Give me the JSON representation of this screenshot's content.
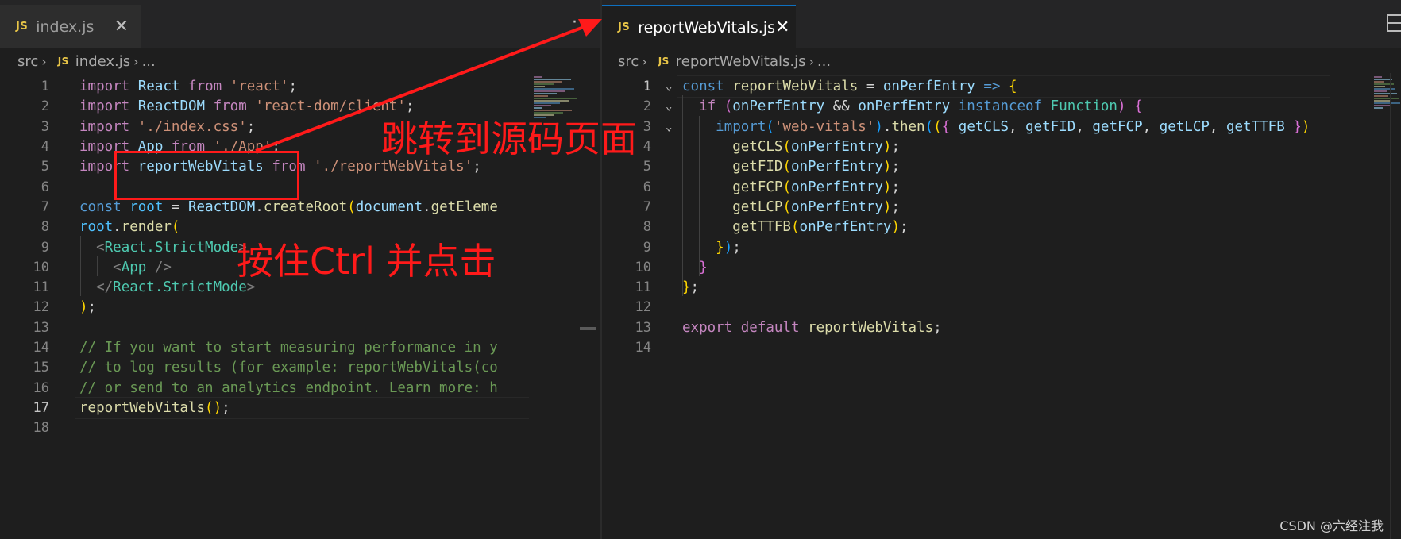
{
  "left_editor": {
    "tab": {
      "badge": "JS",
      "label": "index.js",
      "close_glyph": "✕"
    },
    "more_glyph": "···",
    "breadcrumb": {
      "folder": "src",
      "badge": "JS",
      "file": "index.js",
      "tail": "..."
    },
    "lines": [
      {
        "n": "1",
        "tokens": [
          [
            "imp",
            "import"
          ],
          [
            "pun",
            " "
          ],
          [
            "id",
            "React"
          ],
          [
            "pun",
            " "
          ],
          [
            "imp",
            "from"
          ],
          [
            "pun",
            " "
          ],
          [
            "str",
            "'react'"
          ],
          [
            "pun",
            ";"
          ]
        ]
      },
      {
        "n": "2",
        "tokens": [
          [
            "imp",
            "import"
          ],
          [
            "pun",
            " "
          ],
          [
            "id",
            "ReactDOM"
          ],
          [
            "pun",
            " "
          ],
          [
            "imp",
            "from"
          ],
          [
            "pun",
            " "
          ],
          [
            "str",
            "'react-dom/client'"
          ],
          [
            "pun",
            ";"
          ]
        ]
      },
      {
        "n": "3",
        "tokens": [
          [
            "imp",
            "import"
          ],
          [
            "pun",
            " "
          ],
          [
            "str",
            "'./index.css'"
          ],
          [
            "pun",
            ";"
          ]
        ]
      },
      {
        "n": "4",
        "tokens": [
          [
            "imp",
            "import"
          ],
          [
            "pun",
            " "
          ],
          [
            "id",
            "App"
          ],
          [
            "pun",
            " "
          ],
          [
            "imp",
            "from"
          ],
          [
            "pun",
            " "
          ],
          [
            "str",
            "'./App'"
          ],
          [
            "pun",
            ";"
          ]
        ]
      },
      {
        "n": "5",
        "tokens": [
          [
            "imp",
            "import"
          ],
          [
            "pun",
            " "
          ],
          [
            "id",
            "reportWebVitals"
          ],
          [
            "pun",
            " "
          ],
          [
            "imp",
            "from"
          ],
          [
            "pun",
            " "
          ],
          [
            "str",
            "'./reportWebVitals'"
          ],
          [
            "pun",
            ";"
          ]
        ]
      },
      {
        "n": "6",
        "tokens": []
      },
      {
        "n": "7",
        "tokens": [
          [
            "kw",
            "const"
          ],
          [
            "pun",
            " "
          ],
          [
            "cst",
            "root"
          ],
          [
            "pun",
            " = "
          ],
          [
            "id",
            "ReactDOM"
          ],
          [
            "pun",
            "."
          ],
          [
            "fn",
            "createRoot"
          ],
          [
            "b1",
            "("
          ],
          [
            "id",
            "document"
          ],
          [
            "pun",
            "."
          ],
          [
            "fn",
            "getEleme"
          ]
        ]
      },
      {
        "n": "8",
        "tokens": [
          [
            "cst",
            "root"
          ],
          [
            "pun",
            "."
          ],
          [
            "fn",
            "render"
          ],
          [
            "b1",
            "("
          ]
        ]
      },
      {
        "n": "9",
        "tokens": [
          [
            "pun",
            "  "
          ],
          [
            "tag",
            "<"
          ],
          [
            "cls",
            "React.StrictMode"
          ],
          [
            "tag",
            ">"
          ]
        ]
      },
      {
        "n": "10",
        "tokens": [
          [
            "pun",
            "    "
          ],
          [
            "tag",
            "<"
          ],
          [
            "cls",
            "App"
          ],
          [
            "pun",
            " "
          ],
          [
            "tag",
            "/>"
          ]
        ]
      },
      {
        "n": "11",
        "tokens": [
          [
            "pun",
            "  "
          ],
          [
            "tag",
            "</"
          ],
          [
            "cls",
            "React.StrictMode"
          ],
          [
            "tag",
            ">"
          ]
        ]
      },
      {
        "n": "12",
        "tokens": [
          [
            "b1",
            ")"
          ],
          [
            "pun",
            ";"
          ]
        ]
      },
      {
        "n": "13",
        "tokens": []
      },
      {
        "n": "14",
        "tokens": [
          [
            "cmt",
            "// If you want to start measuring performance in y"
          ]
        ]
      },
      {
        "n": "15",
        "tokens": [
          [
            "cmt",
            "// to log results (for example: reportWebVitals(co"
          ]
        ]
      },
      {
        "n": "16",
        "tokens": [
          [
            "cmt",
            "// or send to an analytics endpoint. Learn more: h"
          ]
        ]
      },
      {
        "n": "17",
        "tokens": [
          [
            "fn",
            "reportWebVitals"
          ],
          [
            "b1",
            "()"
          ],
          [
            "pun",
            ";"
          ]
        ],
        "active": true
      },
      {
        "n": "18",
        "tokens": []
      }
    ]
  },
  "right_editor": {
    "tab": {
      "badge": "JS",
      "label": "reportWebVitals.js",
      "close_glyph": "✕"
    },
    "breadcrumb": {
      "folder": "src",
      "badge": "JS",
      "file": "reportWebVitals.js",
      "tail": "..."
    },
    "lines": [
      {
        "n": "1",
        "fold": true,
        "active": true,
        "tokens": [
          [
            "kw",
            "const"
          ],
          [
            "pun",
            " "
          ],
          [
            "fn",
            "reportWebVitals"
          ],
          [
            "pun",
            " = "
          ],
          [
            "id",
            "onPerfEntry"
          ],
          [
            "pun",
            " "
          ],
          [
            "kw",
            "=>"
          ],
          [
            "pun",
            " "
          ],
          [
            "b1",
            "{"
          ]
        ]
      },
      {
        "n": "2",
        "fold": true,
        "tokens": [
          [
            "pun",
            "  "
          ],
          [
            "imp",
            "if"
          ],
          [
            "pun",
            " "
          ],
          [
            "b2",
            "("
          ],
          [
            "id",
            "onPerfEntry"
          ],
          [
            "pun",
            " && "
          ],
          [
            "id",
            "onPerfEntry"
          ],
          [
            "pun",
            " "
          ],
          [
            "kw",
            "instanceof"
          ],
          [
            "pun",
            " "
          ],
          [
            "cls",
            "Function"
          ],
          [
            "b2",
            ")"
          ],
          [
            "pun",
            " "
          ],
          [
            "b2",
            "{"
          ]
        ]
      },
      {
        "n": "3",
        "fold": true,
        "tokens": [
          [
            "pun",
            "    "
          ],
          [
            "kw",
            "import"
          ],
          [
            "b3",
            "("
          ],
          [
            "str",
            "'web-vitals'"
          ],
          [
            "b3",
            ")"
          ],
          [
            "pun",
            "."
          ],
          [
            "fn",
            "then"
          ],
          [
            "b3",
            "("
          ],
          [
            "b1",
            "("
          ],
          [
            "b2",
            "{"
          ],
          [
            "pun",
            " "
          ],
          [
            "id",
            "getCLS"
          ],
          [
            "pun",
            ", "
          ],
          [
            "id",
            "getFID"
          ],
          [
            "pun",
            ", "
          ],
          [
            "id",
            "getFCP"
          ],
          [
            "pun",
            ", "
          ],
          [
            "id",
            "getLCP"
          ],
          [
            "pun",
            ", "
          ],
          [
            "id",
            "getTTFB"
          ],
          [
            "pun",
            " "
          ],
          [
            "b2",
            "}"
          ],
          [
            "b1",
            ")"
          ]
        ]
      },
      {
        "n": "4",
        "tokens": [
          [
            "pun",
            "      "
          ],
          [
            "fn",
            "getCLS"
          ],
          [
            "b1",
            "("
          ],
          [
            "id",
            "onPerfEntry"
          ],
          [
            "b1",
            ")"
          ],
          [
            "pun",
            ";"
          ]
        ]
      },
      {
        "n": "5",
        "tokens": [
          [
            "pun",
            "      "
          ],
          [
            "fn",
            "getFID"
          ],
          [
            "b1",
            "("
          ],
          [
            "id",
            "onPerfEntry"
          ],
          [
            "b1",
            ")"
          ],
          [
            "pun",
            ";"
          ]
        ]
      },
      {
        "n": "6",
        "tokens": [
          [
            "pun",
            "      "
          ],
          [
            "fn",
            "getFCP"
          ],
          [
            "b1",
            "("
          ],
          [
            "id",
            "onPerfEntry"
          ],
          [
            "b1",
            ")"
          ],
          [
            "pun",
            ";"
          ]
        ]
      },
      {
        "n": "7",
        "tokens": [
          [
            "pun",
            "      "
          ],
          [
            "fn",
            "getLCP"
          ],
          [
            "b1",
            "("
          ],
          [
            "id",
            "onPerfEntry"
          ],
          [
            "b1",
            ")"
          ],
          [
            "pun",
            ";"
          ]
        ]
      },
      {
        "n": "8",
        "tokens": [
          [
            "pun",
            "      "
          ],
          [
            "fn",
            "getTTFB"
          ],
          [
            "b1",
            "("
          ],
          [
            "id",
            "onPerfEntry"
          ],
          [
            "b1",
            ")"
          ],
          [
            "pun",
            ";"
          ]
        ]
      },
      {
        "n": "9",
        "tokens": [
          [
            "pun",
            "    "
          ],
          [
            "b1",
            "}"
          ],
          [
            "b3",
            ")"
          ],
          [
            "pun",
            ";"
          ]
        ]
      },
      {
        "n": "10",
        "tokens": [
          [
            "pun",
            "  "
          ],
          [
            "b2",
            "}"
          ]
        ]
      },
      {
        "n": "11",
        "tokens": [
          [
            "b1",
            "}"
          ],
          [
            "pun",
            ";"
          ]
        ]
      },
      {
        "n": "12",
        "tokens": []
      },
      {
        "n": "13",
        "tokens": [
          [
            "imp",
            "export"
          ],
          [
            "pun",
            " "
          ],
          [
            "imp",
            "default"
          ],
          [
            "pun",
            " "
          ],
          [
            "fn",
            "reportWebVitals"
          ],
          [
            "pun",
            ";"
          ]
        ]
      },
      {
        "n": "14",
        "tokens": []
      }
    ]
  },
  "annotations": {
    "jump_label": "跳转到源码页面",
    "ctrl_label": "按住Ctrl 并点击"
  },
  "watermark": "CSDN @六经注我",
  "colors": {
    "annotation": "#ff1a1a",
    "active_tab_border": "#0e70c0",
    "js_badge": "#e8c547"
  }
}
